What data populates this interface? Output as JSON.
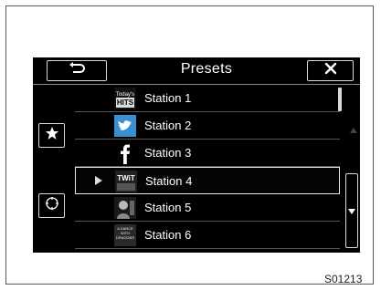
{
  "header": {
    "title": "Presets",
    "back_icon": "back-arrow-icon",
    "close_icon": "close-icon"
  },
  "sidebar": {
    "favorite_icon": "star-icon",
    "tune_icon": "tune-dial-icon"
  },
  "presets": [
    {
      "label": "Station 1",
      "thumb_text": "HITS",
      "thumb_icon": "todays-hits-logo"
    },
    {
      "label": "Station 2",
      "thumb_icon": "twitter-bird-icon"
    },
    {
      "label": "Station 3",
      "thumb_icon": "facebook-f-icon"
    },
    {
      "label": "Station 4",
      "thumb_text": "TWiT",
      "thumb_icon": "twit-logo",
      "selected": true
    },
    {
      "label": "Station 5",
      "thumb_icon": "podcast-artwork"
    },
    {
      "label": "Station 6",
      "thumb_text": "A DANCE WITH DRAGONS",
      "thumb_icon": "audiobook-cover"
    }
  ],
  "scroll": {
    "up_icon": "triangle-up-icon",
    "down_icon": "triangle-down-icon"
  },
  "figure_code": "S01213",
  "colors": {
    "screen_bg": "#000000",
    "text": "#ffffff",
    "twitter_blue": "#55acee",
    "facebook_blue": "#3b5998"
  }
}
